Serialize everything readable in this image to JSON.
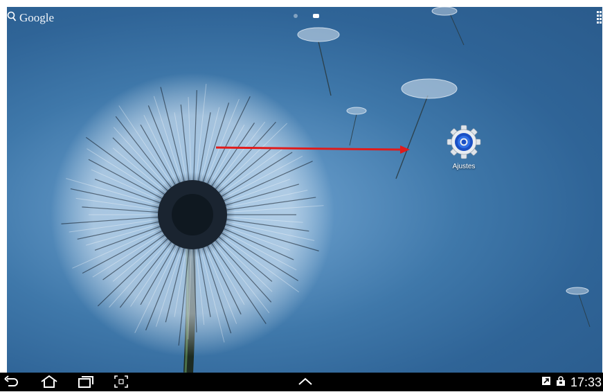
{
  "search_bar": {
    "label": "Google",
    "icon": "search-icon"
  },
  "home_pages": {
    "count": 2,
    "active_index": 1
  },
  "apps_button": {
    "icon": "apps-grid-icon"
  },
  "shortcuts": [
    {
      "label": "Ajustes",
      "icon": "settings-gear-icon",
      "accent": "#1a4fc4"
    }
  ],
  "annotation": {
    "type": "arrow",
    "color": "#e01b1b"
  },
  "nav_bar": {
    "buttons": [
      "back-icon",
      "home-icon",
      "recent-apps-icon",
      "screenshot-icon",
      "mini-apps-tray-icon"
    ],
    "status_icons": [
      "notification-icon",
      "usb-connected-icon"
    ],
    "clock": "17:33"
  },
  "colors": {
    "wallpaper_light": "#7fb0d8",
    "wallpaper_dark": "#2a5b8c",
    "nav_bar": "#000000"
  }
}
